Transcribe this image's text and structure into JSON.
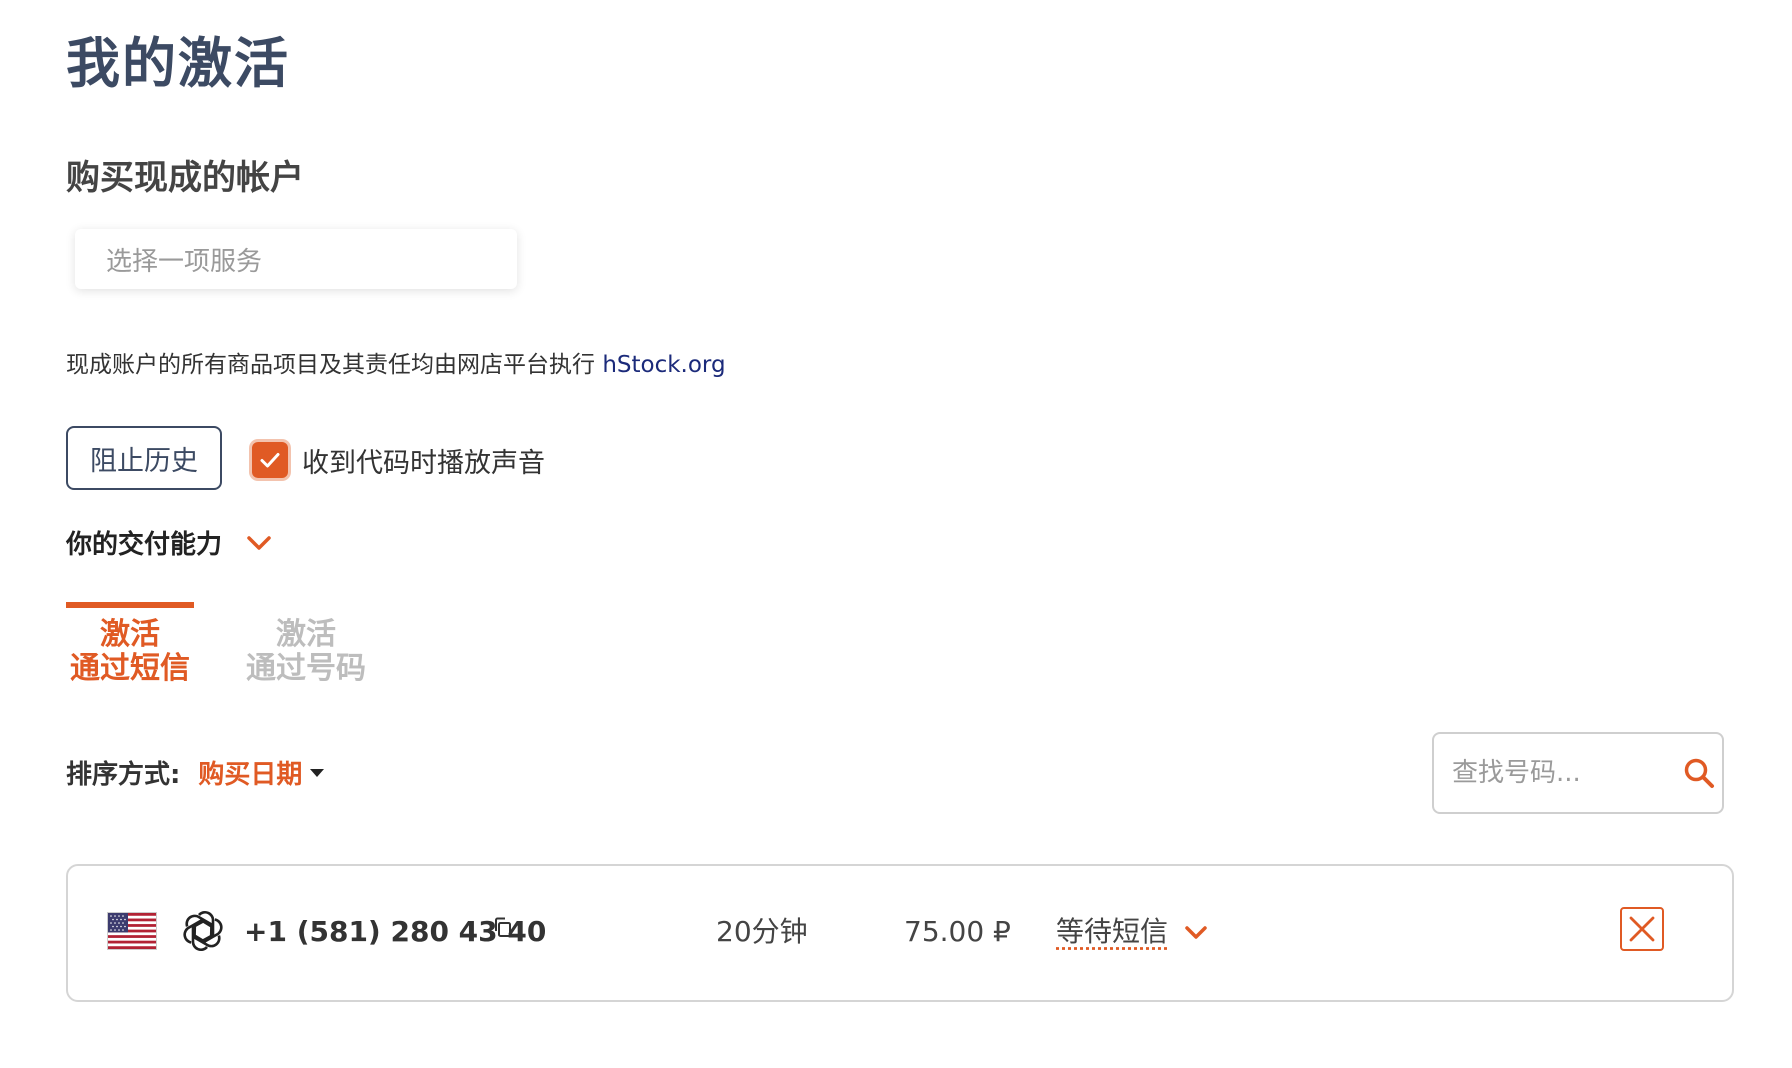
{
  "page": {
    "title": "我的激活"
  },
  "ready_accounts": {
    "section_title": "购买现成的帐户",
    "service_select_placeholder": "选择一项服务",
    "info_text": "现成账户的所有商品项目及其责任均由网店平台执行",
    "info_link_text": "hStock.org"
  },
  "controls": {
    "block_history_label": "阻止历史",
    "sound_checkbox_label": "收到代码时播放声音",
    "sound_checkbox_checked": true,
    "delivery_capability_label": "你的交付能力"
  },
  "tabs": [
    {
      "line1": "激活",
      "line2": "通过短信",
      "active": true
    },
    {
      "line1": "激活",
      "line2": "通过号码",
      "active": false
    }
  ],
  "sort": {
    "label": "排序方式:",
    "value": "购买日期"
  },
  "search": {
    "placeholder": "查找号码..."
  },
  "activations": [
    {
      "country_flag": "us-flag-icon",
      "service_icon": "openai-icon",
      "phone": "+1 (581) 280 43 40",
      "time_left": "20分钟",
      "price": "75.00 ₽",
      "status": "等待短信"
    }
  ],
  "colors": {
    "accent": "#e05a24",
    "title": "#3c4a63",
    "link": "#1b2a7a",
    "border": "#d5d5d5"
  }
}
